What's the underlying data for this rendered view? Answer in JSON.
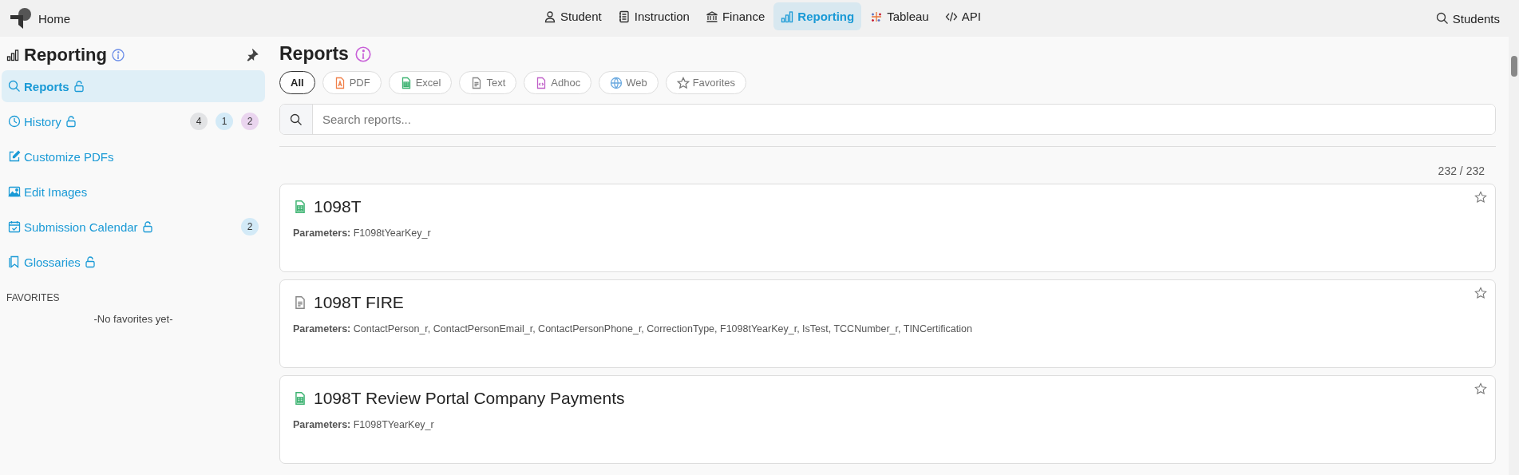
{
  "topbar": {
    "home": "Home",
    "nav": [
      {
        "label": "Student",
        "kind": "person",
        "selected": false
      },
      {
        "label": "Instruction",
        "kind": "notebook",
        "selected": false
      },
      {
        "label": "Finance",
        "kind": "bank",
        "selected": false
      },
      {
        "label": "Reporting",
        "kind": "chart",
        "selected": true
      },
      {
        "label": "Tableau",
        "kind": "tableau",
        "selected": false
      },
      {
        "label": "API",
        "kind": "code",
        "selected": false
      }
    ],
    "search_label": "Students"
  },
  "sidebar": {
    "title": "Reporting",
    "items": [
      {
        "label": "Reports",
        "kind": "search",
        "locked": false,
        "selected": true
      },
      {
        "label": "History",
        "kind": "clock",
        "locked": false,
        "selected": false,
        "badges": [
          {
            "text": "4",
            "color": "#e2e3e5"
          },
          {
            "text": "1",
            "color": "#d3eaf7"
          },
          {
            "text": "2",
            "color": "#ead5ef"
          }
        ]
      },
      {
        "label": "Customize PDFs",
        "kind": "edit",
        "selected": false
      },
      {
        "label": "Edit Images",
        "kind": "image",
        "selected": false
      },
      {
        "label": "Submission Calendar",
        "kind": "calendar",
        "locked": false,
        "selected": false,
        "badges": [
          {
            "text": "2",
            "color": "#d3eaf7"
          }
        ]
      },
      {
        "label": "Glossaries",
        "kind": "bookmark",
        "locked": false,
        "selected": false
      }
    ],
    "favorites_heading": "FAVORITES",
    "favorites_empty": "-No favorites yet-"
  },
  "main": {
    "title": "Reports",
    "filters": [
      {
        "label": "All",
        "kind": "all",
        "selected": true
      },
      {
        "label": "PDF",
        "kind": "pdf",
        "selected": false
      },
      {
        "label": "Excel",
        "kind": "excel",
        "selected": false
      },
      {
        "label": "Text",
        "kind": "text",
        "selected": false
      },
      {
        "label": "Adhoc",
        "kind": "adhoc",
        "selected": false
      },
      {
        "label": "Web",
        "kind": "web",
        "selected": false
      },
      {
        "label": "Favorites",
        "kind": "star",
        "selected": false
      }
    ],
    "search": {
      "placeholder": "Search reports..."
    },
    "count": "232 / 232",
    "reports": [
      {
        "title": "1098T",
        "kind": "excel",
        "parameters_label": "Parameters:",
        "parameters": "F1098tYearKey_r",
        "favorite": false
      },
      {
        "title": "1098T FIRE",
        "kind": "text",
        "parameters_label": "Parameters:",
        "parameters": "ContactPerson_r, ContactPersonEmail_r, ContactPersonPhone_r, CorrectionType, F1098tYearKey_r, IsTest, TCCNumber_r, TINCertification",
        "favorite": false
      },
      {
        "title": "1098T Review Portal Company Payments",
        "kind": "excel",
        "parameters_label": "Parameters:",
        "parameters": "F1098TYearKey_r",
        "favorite": false
      }
    ]
  }
}
